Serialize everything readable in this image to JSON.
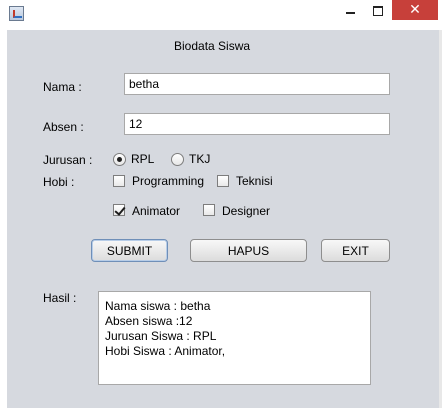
{
  "window": {
    "close_glyph": "✕"
  },
  "form": {
    "title": "Biodata Siswa",
    "nama_label": "Nama :",
    "nama_value": "betha",
    "absen_label": "Absen :",
    "absen_value": "12",
    "jurusan_label": "Jurusan :",
    "jurusan_options": [
      {
        "label": "RPL",
        "selected": true
      },
      {
        "label": "TKJ",
        "selected": false
      }
    ],
    "hobi_label": "Hobi :",
    "hobi_options": [
      {
        "label": "Programming",
        "checked": false
      },
      {
        "label": "Teknisi",
        "checked": false
      },
      {
        "label": "Animator",
        "checked": true
      },
      {
        "label": "Designer",
        "checked": false
      }
    ],
    "buttons": {
      "submit": "SUBMIT",
      "hapus": "HAPUS",
      "exit": "EXIT"
    },
    "hasil_label": "Hasil :",
    "hasil_lines": [
      "Nama siswa : betha",
      "Absen siswa :12",
      "Jurusan Siswa : RPL",
      "Hobi Siswa : Animator,"
    ]
  },
  "colors": {
    "panel_background": "#d6d9df",
    "close_button": "#c7403a"
  }
}
